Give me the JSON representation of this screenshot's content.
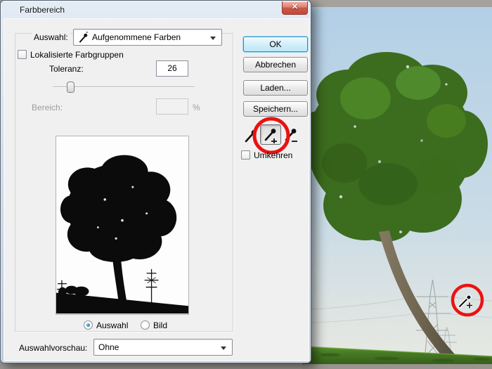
{
  "window": {
    "title": "Farbbereich",
    "close_glyph": "✕"
  },
  "selection": {
    "auswahl_label": "Auswahl:",
    "auswahl_value": "Aufgenommene Farben",
    "localized_label": "Lokalisierte Farbgruppen",
    "toleranz_label": "Toleranz:",
    "toleranz_value": "26",
    "bereich_label": "Bereich:",
    "bereich_value": "",
    "percent_label": "%",
    "radio_auswahl_label": "Auswahl",
    "radio_bild_label": "Bild",
    "vorschau_label": "Auswahlvorschau:",
    "vorschau_value": "Ohne",
    "umkehren_label": "Umkehren"
  },
  "buttons": {
    "ok": "OK",
    "cancel": "Abbrechen",
    "load": "Laden...",
    "save": "Speichern..."
  },
  "icons": {
    "eyedropper": "eyedropper",
    "eyedropper_plus": "eyedropper-plus",
    "eyedropper_minus": "eyedropper-minus"
  },
  "colors": {
    "annotation_red": "#e81212",
    "sky": "#b5d1e6",
    "canopy_green": "#3c6c1e",
    "field_green": "#4a7f26",
    "dialog_bg": "#f0f0f0"
  }
}
